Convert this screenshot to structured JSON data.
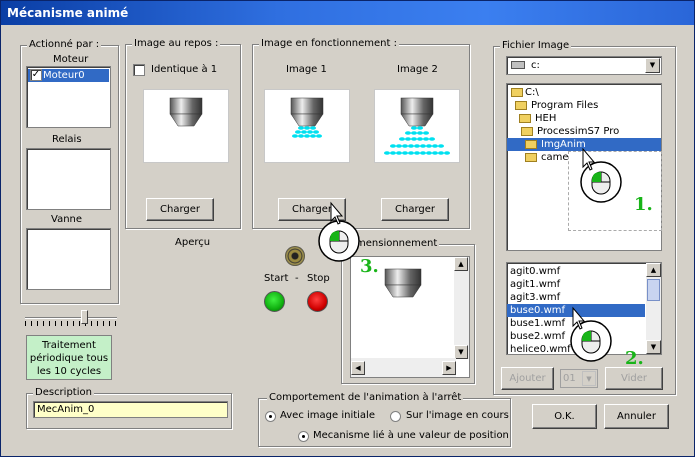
{
  "window": {
    "title": "Mécanisme animé"
  },
  "actionne": {
    "title": "Actionné par :",
    "moteur_label": "Moteur",
    "moteur_items": [
      {
        "label": "Moteur0",
        "checked": true
      }
    ],
    "relais_label": "Relais",
    "vanne_label": "Vanne"
  },
  "periodic": {
    "line1": "Traitement",
    "line2": "périodique tous",
    "line3": "les 10 cycles"
  },
  "description": {
    "label": "Description",
    "value": "MecAnim_0"
  },
  "repos": {
    "title": "Image au repos :",
    "checkbox_label": "Identique à 1",
    "charger": "Charger"
  },
  "fonctionnement": {
    "title": "Image en fonctionnement :",
    "image1": "Image 1",
    "image2": "Image 2",
    "charger1": "Charger",
    "charger2": "Charger"
  },
  "apercu": {
    "label": "Aperçu",
    "start": "Start",
    "dash": "-",
    "stop": "Stop"
  },
  "dimension": {
    "title": "mensionnement"
  },
  "comportement": {
    "title": "Comportement de l'animation à l'arrêt",
    "radio1": "Avec image initiale",
    "radio2": "Sur l'image en cours",
    "radio3": "Mecanisme lié à une valeur de position"
  },
  "fichier": {
    "title": "Fichier Image",
    "drive": "c:",
    "folders": [
      "C:\\",
      "Program Files",
      "HEH",
      "ProcessimS7 Pro",
      "ImgAnim",
      "came"
    ],
    "selected_folder": "ImgAnim",
    "files": [
      "agit0.wmf",
      "agit1.wmf",
      "agit3.wmf",
      "buse0.wmf",
      "buse1.wmf",
      "buse2.wmf",
      "helice0.wmf"
    ],
    "selected_file": "buse0.wmf",
    "ajouter": "Ajouter",
    "count": "01",
    "vider": "Vider"
  },
  "buttons": {
    "ok": "O.K.",
    "annuler": "Annuler"
  },
  "steps": {
    "s1": "1.",
    "s2": "2.",
    "s3": "3."
  },
  "colors": {
    "title_bar": "#0a3ea5",
    "selection": "#316ac5",
    "periodic_bg": "#c4f0c8",
    "description_bg": "#ffffc8",
    "spray": "#00e0f0",
    "step_green": "#18b418"
  }
}
